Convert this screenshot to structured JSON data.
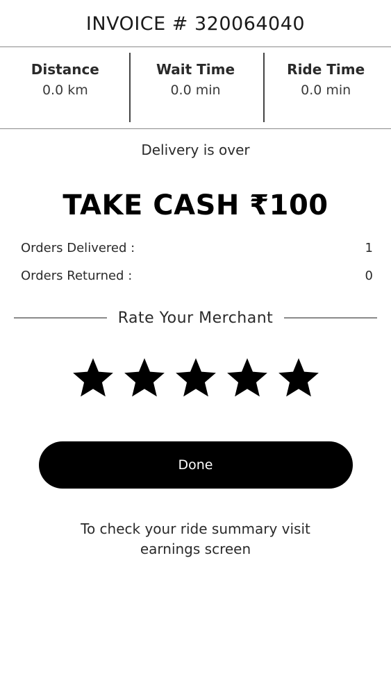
{
  "header": {
    "title": "INVOICE # 320064040"
  },
  "stats": [
    {
      "label": "Distance",
      "value": "0.0 km"
    },
    {
      "label": "Wait Time",
      "value": "0.0 min"
    },
    {
      "label": "Ride Time",
      "value": "0.0 min"
    }
  ],
  "status_text": "Delivery is over",
  "cash_text": "TAKE CASH ₹100",
  "orders": [
    {
      "label": "Orders Delivered :",
      "value": "1"
    },
    {
      "label": "Orders Returned :",
      "value": "0"
    }
  ],
  "rating": {
    "label": "Rate Your Merchant",
    "filled": 5,
    "max": 5,
    "star_icon": "star-icon",
    "star_color": "#000000"
  },
  "done_button": {
    "label": "Done",
    "color": "#000000"
  },
  "note": "To check your ride summary visit earnings screen"
}
